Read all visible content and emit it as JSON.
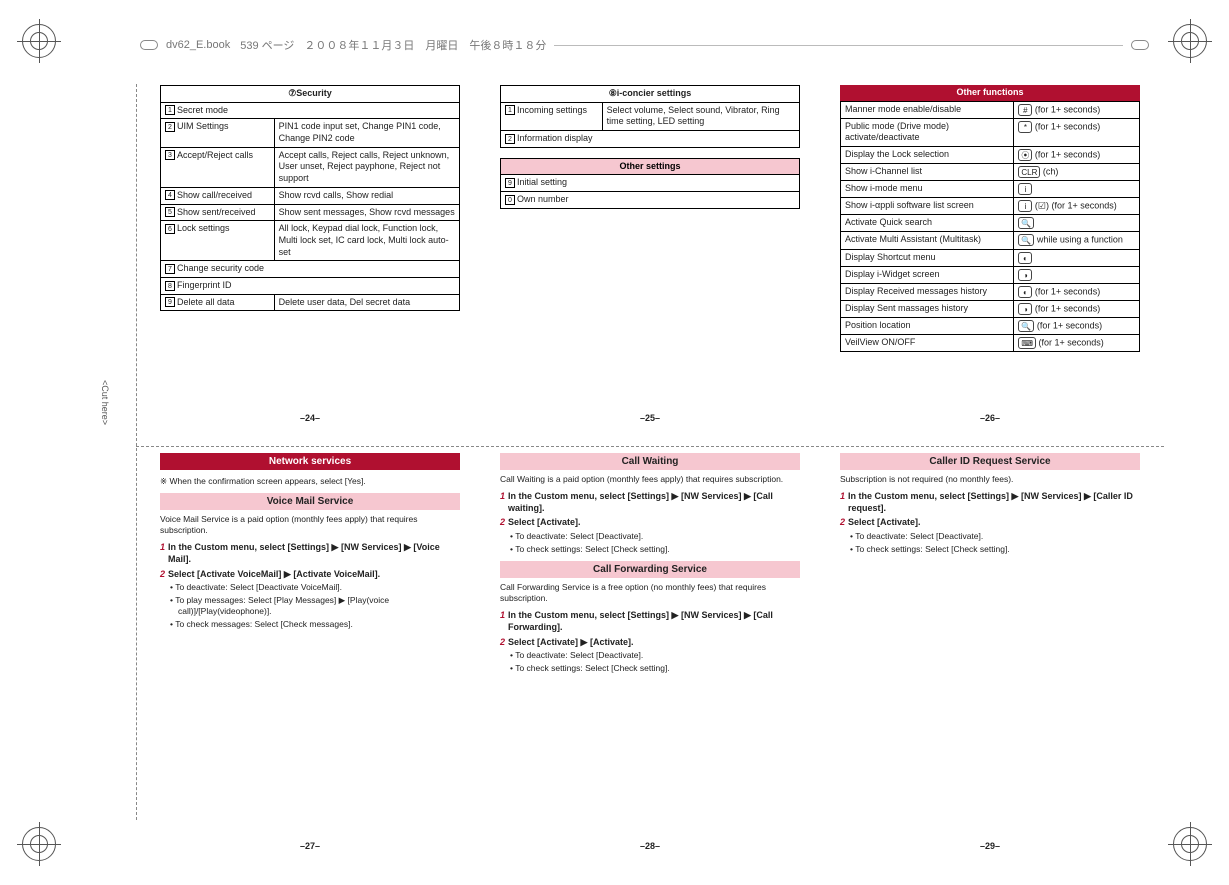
{
  "header": {
    "filename": "dv62_E.book",
    "page": "539 ページ",
    "date": "２００８年１１月３日　月曜日　午後８時１８分"
  },
  "cut_here": "<Cut here>",
  "panels": {
    "p24": {
      "pgnum": "–24–",
      "security": {
        "title": "⑦Security",
        "rows": [
          {
            "n": "1",
            "l": "Secret mode",
            "r": ""
          },
          {
            "n": "2",
            "l": "UIM Settings",
            "r": "PIN1 code input set, Change PIN1 code, Change PIN2 code"
          },
          {
            "n": "3",
            "l": "Accept/Reject calls",
            "r": "Accept calls, Reject calls, Reject unknown, User unset, Reject payphone, Reject not support"
          },
          {
            "n": "4",
            "l": "Show call/received",
            "r": "Show rcvd calls, Show redial"
          },
          {
            "n": "5",
            "l": "Show sent/received",
            "r": "Show sent messages, Show rcvd messages"
          },
          {
            "n": "6",
            "l": "Lock settings",
            "r": "All lock, Keypad dial lock, Function lock, Multi lock set, IC card lock, Multi lock auto-set"
          },
          {
            "n": "7",
            "l": "Change security code",
            "r": ""
          },
          {
            "n": "8",
            "l": "Fingerprint ID",
            "r": ""
          },
          {
            "n": "9",
            "l": "Delete all data",
            "r": "Delete user data, Del secret data"
          }
        ]
      }
    },
    "p25": {
      "pgnum": "–25–",
      "iconcier": {
        "title": "⑧i-concier settings",
        "rows": [
          {
            "n": "1",
            "l": "Incoming settings",
            "r": "Select volume, Select sound, Vibrator, Ring time setting, LED setting"
          },
          {
            "n": "2",
            "l": "Information display",
            "r": ""
          }
        ]
      },
      "other_settings": {
        "title": "Other settings",
        "rows": [
          {
            "n": "9",
            "l": "Initial setting"
          },
          {
            "n": "0",
            "l": "Own number"
          }
        ]
      }
    },
    "p26": {
      "pgnum": "–26–",
      "title": "Other functions",
      "rows": [
        {
          "l": "Manner mode enable/disable",
          "k": "#",
          "r": "(for 1+ seconds)"
        },
        {
          "l": "Public mode (Drive mode) activate/deactivate",
          "k": "*",
          "r": "(for 1+ seconds)"
        },
        {
          "l": "Display the Lock selection",
          "k": "⦿",
          "r": "(for 1+ seconds)"
        },
        {
          "l": "Show i-Channel list",
          "k": "CLR",
          "r": "(ch)"
        },
        {
          "l": "Show i-mode menu",
          "k": "i",
          "r": ""
        },
        {
          "l": "Show i-αppli software list screen",
          "k": "i",
          "r": "(☑) (for 1+ seconds)"
        },
        {
          "l": "Activate Quick search",
          "k": "🔍",
          "r": ""
        },
        {
          "l": "Activate Multi Assistant (Multitask)",
          "k": "🔍",
          "r": "while using a function"
        },
        {
          "l": "Display Shortcut menu",
          "k": "◐",
          "r": ""
        },
        {
          "l": "Display i-Widget screen",
          "k": "◑",
          "r": ""
        },
        {
          "l": "Display Received messages history",
          "k": "◐",
          "r": "(for 1+ seconds)"
        },
        {
          "l": "Display Sent massages history",
          "k": "◑",
          "r": "(for 1+ seconds)"
        },
        {
          "l": "Position location",
          "k": "🔍",
          "r": "(for 1+ seconds)"
        },
        {
          "l": "VeilView ON/OFF",
          "k": "⌨",
          "r": "(for 1+ seconds)"
        }
      ]
    },
    "p27": {
      "pgnum": "–27–",
      "ns_title": "Network services",
      "ns_note": "※ When the confirmation screen appears, select [Yes].",
      "vms_title": "Voice Mail Service",
      "vms_note": "Voice Mail Service is a paid option (monthly fees apply) that requires subscription.",
      "step1": "In the Custom menu, select [Settings] ▶ [NW Services] ▶ [Voice Mail].",
      "step2": "Select [Activate VoiceMail] ▶ [Activate VoiceMail].",
      "b1": "To deactivate: Select [Deactivate VoiceMail].",
      "b2": "To play messages: Select [Play Messages] ▶ [Play(voice call)]/[Play(videophone)].",
      "b3": "To check messages: Select [Check messages]."
    },
    "p28": {
      "pgnum": "–28–",
      "cw_title": "Call Waiting",
      "cw_note": "Call Waiting is a paid option (monthly fees apply) that requires subscription.",
      "cw_step1": "In the Custom menu, select [Settings] ▶ [NW Services] ▶ [Call waiting].",
      "cw_step2": "Select [Activate].",
      "cw_b1": "To deactivate: Select [Deactivate].",
      "cw_b2": "To check settings: Select [Check setting].",
      "cf_title": "Call Forwarding Service",
      "cf_note": "Call Forwarding Service is a free option (no monthly fees) that requires subscription.",
      "cf_step1": "In the Custom menu, select [Settings] ▶ [NW Services] ▶ [Call Forwarding].",
      "cf_step2": "Select [Activate] ▶ [Activate].",
      "cf_b1": "To deactivate: Select [Deactivate].",
      "cf_b2": "To check settings: Select [Check setting]."
    },
    "p29": {
      "pgnum": "–29–",
      "title": "Caller ID Request Service",
      "note": "Subscription is not required (no monthly fees).",
      "step1": "In the Custom menu, select [Settings] ▶ [NW Services] ▶ [Caller ID request].",
      "step2": "Select [Activate].",
      "b1": "To deactivate: Select [Deactivate].",
      "b2": "To check settings: Select [Check setting]."
    }
  }
}
